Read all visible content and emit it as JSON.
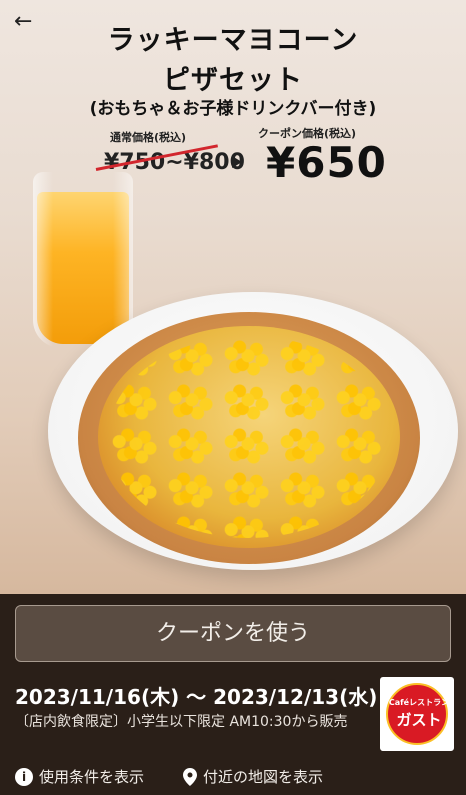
{
  "nav": {
    "back_icon": "back-arrow-icon"
  },
  "hero": {
    "title_line1": "ラッキーマヨコーン",
    "title_line2": "ピザセット",
    "title_line3": "(おもちゃ＆お子様ドリンクバー付き)",
    "regular_price_label": "通常価格(税込)",
    "regular_price": "¥750~¥800",
    "coupon_price_label": "クーポン価格(税込)",
    "coupon_price": "¥650",
    "strike_color": "#d2262d"
  },
  "cta": {
    "label": "クーポンを使う"
  },
  "validity": {
    "dates": "2023/11/16(木) ～ 2023/12/13(水)",
    "note": "〔店内飲食限定〕小学生以下限定 AM10:30から販売"
  },
  "logo": {
    "top": "Caféレストラン",
    "main": "ガスト",
    "brand_color": "#d91a24"
  },
  "links": {
    "terms": "使用条件を表示",
    "terms_icon": "info-icon",
    "map": "付近の地図を表示",
    "map_icon": "location-pin-icon"
  }
}
